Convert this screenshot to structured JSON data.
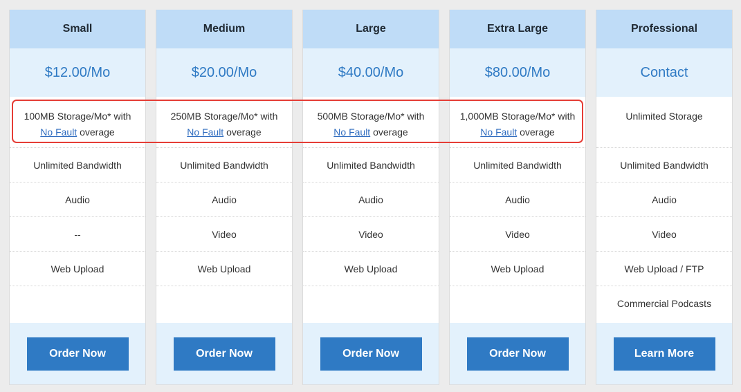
{
  "plans": [
    {
      "name": "Small",
      "price": "$12.00/Mo",
      "storage_prefix": "100MB Storage/Mo* with",
      "storage_link": "No Fault",
      "storage_suffix": " overage",
      "bandwidth": "Unlimited Bandwidth",
      "audio": "Audio",
      "video": "--",
      "upload": "Web Upload",
      "extra": "",
      "button": "Order Now"
    },
    {
      "name": "Medium",
      "price": "$20.00/Mo",
      "storage_prefix": "250MB Storage/Mo* with",
      "storage_link": "No Fault",
      "storage_suffix": " overage",
      "bandwidth": "Unlimited Bandwidth",
      "audio": "Audio",
      "video": "Video",
      "upload": "Web Upload",
      "extra": "",
      "button": "Order Now"
    },
    {
      "name": "Large",
      "price": "$40.00/Mo",
      "storage_prefix": "500MB Storage/Mo* with",
      "storage_link": "No Fault",
      "storage_suffix": " overage",
      "bandwidth": "Unlimited Bandwidth",
      "audio": "Audio",
      "video": "Video",
      "upload": "Web Upload",
      "extra": "",
      "button": "Order Now"
    },
    {
      "name": "Extra Large",
      "price": "$80.00/Mo",
      "storage_prefix": "1,000MB Storage/Mo* with",
      "storage_link": "No Fault",
      "storage_suffix": " overage",
      "bandwidth": "Unlimited Bandwidth",
      "audio": "Audio",
      "video": "Video",
      "upload": "Web Upload",
      "extra": "",
      "button": "Order Now"
    },
    {
      "name": "Professional",
      "price": "Contact",
      "storage_prefix": "Unlimited Storage",
      "storage_link": "",
      "storage_suffix": "",
      "bandwidth": "Unlimited Bandwidth",
      "audio": "Audio",
      "video": "Video",
      "upload": "Web Upload / FTP",
      "extra": "Commercial Podcasts",
      "button": "Learn More"
    }
  ],
  "colors": {
    "header_bg": "#bfdcf7",
    "price_bg": "#e3f1fc",
    "accent": "#2f7ac4",
    "highlight": "#e53d36"
  }
}
